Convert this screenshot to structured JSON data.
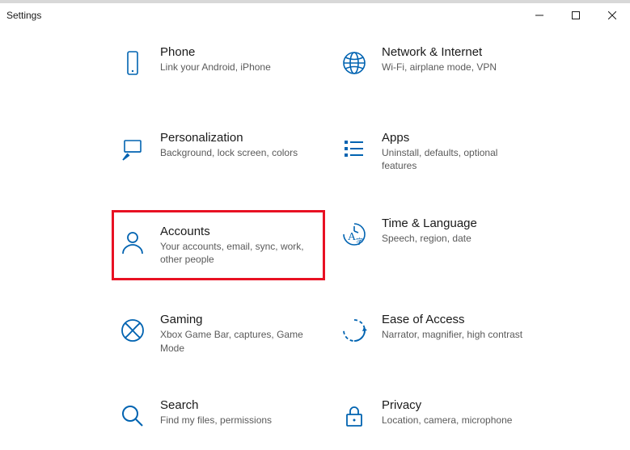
{
  "window": {
    "title": "Settings"
  },
  "tiles": {
    "phone": {
      "title": "Phone",
      "desc": "Link your Android, iPhone"
    },
    "network": {
      "title": "Network & Internet",
      "desc": "Wi-Fi, airplane mode, VPN"
    },
    "personalization": {
      "title": "Personalization",
      "desc": "Background, lock screen, colors"
    },
    "apps": {
      "title": "Apps",
      "desc": "Uninstall, defaults, optional features"
    },
    "accounts": {
      "title": "Accounts",
      "desc": "Your accounts, email, sync, work, other people"
    },
    "time": {
      "title": "Time & Language",
      "desc": "Speech, region, date"
    },
    "gaming": {
      "title": "Gaming",
      "desc": "Xbox Game Bar, captures, Game Mode"
    },
    "ease": {
      "title": "Ease of Access",
      "desc": "Narrator, magnifier, high contrast"
    },
    "search": {
      "title": "Search",
      "desc": "Find my files, permissions"
    },
    "privacy": {
      "title": "Privacy",
      "desc": "Location, camera, microphone"
    }
  }
}
